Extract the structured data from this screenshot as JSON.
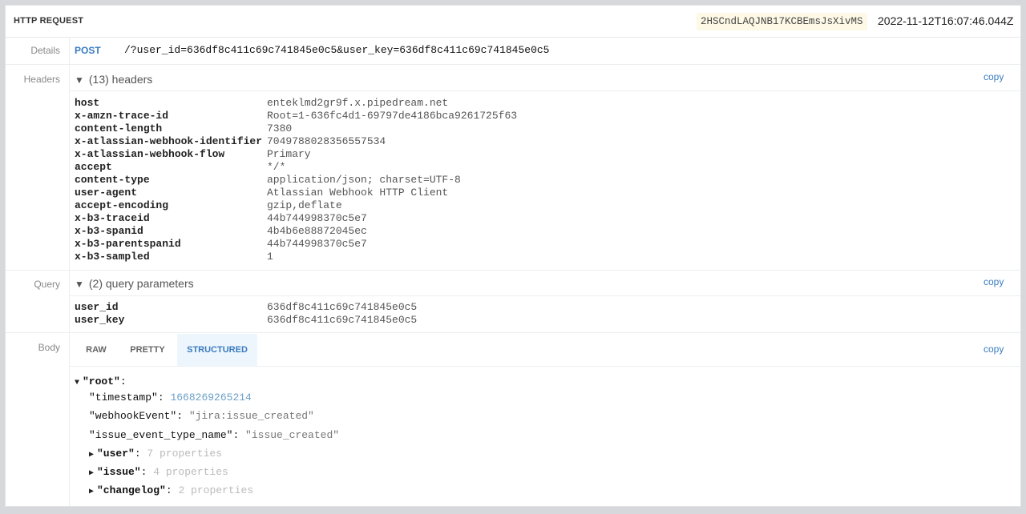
{
  "header": {
    "title": "HTTP REQUEST",
    "request_id": "2HSCndLAQJNB17KCBEmsJsXivMS",
    "timestamp": "2022-11-12T16:07:46.044Z"
  },
  "labels": {
    "details": "Details",
    "headers": "Headers",
    "query": "Query",
    "body": "Body"
  },
  "details": {
    "method": "POST",
    "path": "/?user_id=636df8c411c69c741845e0c5&user_key=636df8c411c69c741845e0c5"
  },
  "headers_section": {
    "toggle_icon": "▼",
    "summary": "(13) headers",
    "copy_label": "copy",
    "items": [
      {
        "key": "host",
        "value": "enteklmd2gr9f.x.pipedream.net"
      },
      {
        "key": "x-amzn-trace-id",
        "value": "Root=1-636fc4d1-69797de4186bca9261725f63"
      },
      {
        "key": "content-length",
        "value": "7380"
      },
      {
        "key": "x-atlassian-webhook-identifier",
        "value": "7049788028356557534"
      },
      {
        "key": "x-atlassian-webhook-flow",
        "value": "Primary"
      },
      {
        "key": "accept",
        "value": "*/*"
      },
      {
        "key": "content-type",
        "value": "application/json; charset=UTF-8"
      },
      {
        "key": "user-agent",
        "value": "Atlassian Webhook HTTP Client"
      },
      {
        "key": "accept-encoding",
        "value": "gzip,deflate"
      },
      {
        "key": "x-b3-traceid",
        "value": "44b744998370c5e7"
      },
      {
        "key": "x-b3-spanid",
        "value": "4b4b6e88872045ec"
      },
      {
        "key": "x-b3-parentspanid",
        "value": "44b744998370c5e7"
      },
      {
        "key": "x-b3-sampled",
        "value": "1"
      }
    ]
  },
  "query_section": {
    "toggle_icon": "▼",
    "summary": "(2) query parameters",
    "copy_label": "copy",
    "items": [
      {
        "key": "user_id",
        "value": "636df8c411c69c741845e0c5"
      },
      {
        "key": "user_key",
        "value": "636df8c411c69c741845e0c5"
      }
    ]
  },
  "body_section": {
    "copy_label": "copy",
    "tabs": [
      "RAW",
      "PRETTY",
      "STRUCTURED"
    ],
    "active_tab": "STRUCTURED",
    "tree": {
      "root_label": "\"root\"",
      "root_colon": ":",
      "expanded_icon": "▼",
      "collapsed_icon": "▶",
      "timestamp_key": "\"timestamp\"",
      "timestamp_value": "1668269265214",
      "webhookEvent_key": "\"webhookEvent\"",
      "webhookEvent_value": "\"jira:issue_created\"",
      "issue_event_type_name_key": "\"issue_event_type_name\"",
      "issue_event_type_name_value": "\"issue_created\"",
      "user_key": "\"user\"",
      "user_summary": "7 properties",
      "issue_key": "\"issue\"",
      "issue_summary": "4 properties",
      "changelog_key": "\"changelog\"",
      "changelog_summary": "2 properties",
      "colon": ": "
    }
  }
}
